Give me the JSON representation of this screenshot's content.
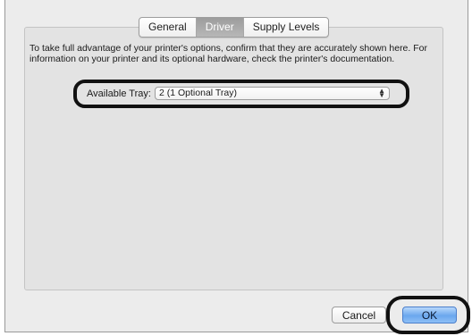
{
  "tabs": [
    {
      "label": "General",
      "active": false
    },
    {
      "label": "Driver",
      "active": true
    },
    {
      "label": "Supply Levels",
      "active": false
    }
  ],
  "description": "To take full advantage of your printer's options, confirm that they are accurately shown here. For information on your printer and its optional hardware, check the printer's documentation.",
  "tray": {
    "label": "Available Tray:",
    "value": "2 (1 Optional Tray)"
  },
  "buttons": {
    "cancel": "Cancel",
    "ok": "OK"
  },
  "colors": {
    "window_bg": "#ececec",
    "active_tab": "#a9a9a9",
    "default_button": "#6aa7ee",
    "highlight": "#111111"
  }
}
